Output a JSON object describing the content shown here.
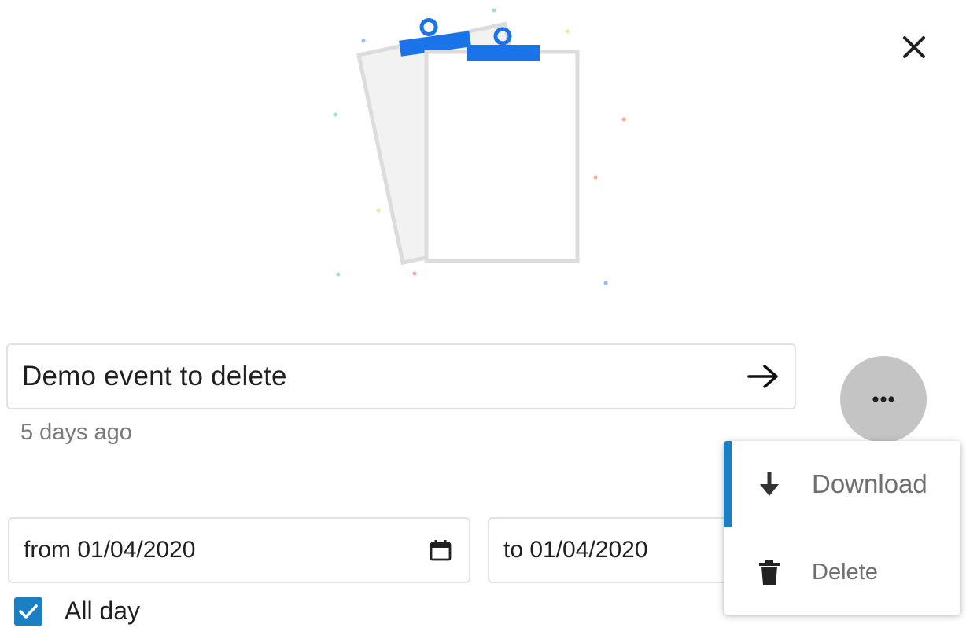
{
  "event": {
    "title": "Demo event to delete",
    "age": "5 days ago"
  },
  "dates": {
    "from": "from 01/04/2020",
    "to": "to 01/04/2020"
  },
  "all_day": {
    "label": "All day",
    "checked": true
  },
  "menu": {
    "items": [
      {
        "label": "Download",
        "icon": "download-arrow-icon",
        "active": true
      },
      {
        "label": "Delete",
        "icon": "trash-icon",
        "active": false
      }
    ]
  },
  "icons": {
    "close": "close-icon",
    "submit": "arrow-right-icon",
    "more": "more-horizontal-icon",
    "calendar": "calendar-icon",
    "checkbox": "check-icon",
    "illustration": "clipboard-illustration"
  },
  "colors": {
    "accent": "#1b7fc4",
    "clip": "#1a73e8",
    "more_button_bg": "#c4c4c4",
    "muted_text": "#7a7a7a"
  }
}
